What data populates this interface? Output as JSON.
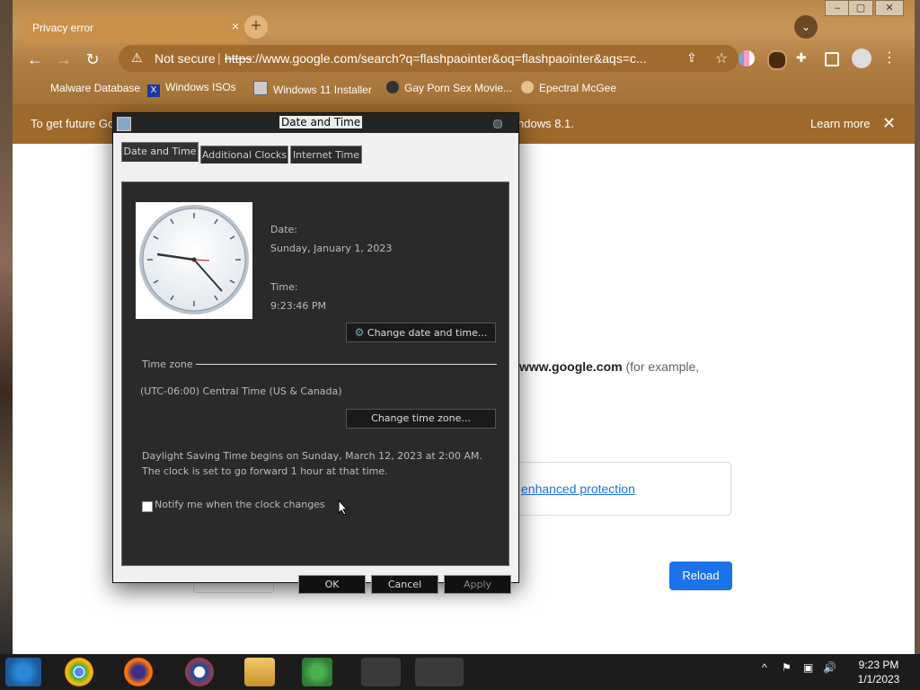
{
  "browser": {
    "tab_title": "Privacy error",
    "tab_close": "×",
    "new_tab": "+",
    "tab_search": "⌄",
    "window_controls": [
      "–",
      "▢",
      "✕"
    ],
    "nav": {
      "back": "←",
      "forward": "→",
      "reload": "↻"
    },
    "omnibox": {
      "warning_icon": "⚠",
      "not_secure": "Not secure",
      "separator": "|",
      "url_scheme": "https",
      "url_rest": "://www.google.com/search?q=flashpaointer&oq=flashpaointer&aqs=c...",
      "share_icon": "⇪",
      "star_icon": "☆"
    },
    "bookmarks": [
      {
        "label": "Malware Database",
        "icon": "folder-icon"
      },
      {
        "label": "Windows ISOs",
        "icon": "x-logo-icon"
      },
      {
        "label": "Windows 11 Installer",
        "icon": "image-icon"
      },
      {
        "label": "Gay Porn Sex Movie...",
        "icon": "face-icon"
      },
      {
        "label": "Epectral McGee",
        "icon": "face-icon"
      }
    ],
    "infobar": {
      "text": "To get future Go",
      "text_tail": "ndows 8.1.",
      "learn_more": "Learn more",
      "close": "✕"
    }
  },
  "page": {
    "error_text_bold": "www.google.com",
    "error_text_rest": " (for example,",
    "enhanced_link": "enhanced protection",
    "reload_button": "Reload"
  },
  "dialog": {
    "title": "Date and Time",
    "tabs": [
      "Date and Time",
      "Additional Clocks",
      "Internet Time"
    ],
    "date_label": "Date:",
    "date_value": "Sunday, January 1, 2023",
    "time_label": "Time:",
    "time_value": "9:23:46 PM",
    "change_datetime_button": "Change date and time...",
    "timezone_heading": "Time zone",
    "timezone_value": "(UTC-06:00) Central Time (US & Canada)",
    "change_timezone_button": "Change time zone...",
    "dst_line1": "Daylight Saving Time begins on Sunday, March 12, 2023 at 2:00 AM.",
    "dst_line2": "The clock is set to go forward 1 hour at that time.",
    "notify_checkbox": "Notify me when the clock changes",
    "ok": "OK",
    "cancel": "Cancel",
    "apply": "Apply"
  },
  "taskbar": {
    "time": "9:23 PM",
    "date": "1/1/2023",
    "tray_chevron": "^",
    "tray_flag": "⚑",
    "tray_network": "▣",
    "tray_volume": "🔊"
  }
}
